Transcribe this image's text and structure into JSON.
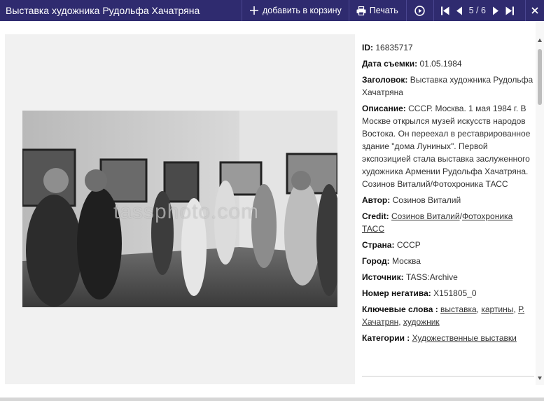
{
  "header": {
    "title": "Выставка художника Рудольфа Хачатряна",
    "add_to_cart_label": "добавить в корзину",
    "print_label": "Печать",
    "pager_text": "5 / 6",
    "icons": {
      "add": "plus-icon",
      "print": "printer-icon",
      "slideshow": "play-circle-icon",
      "first": "first-page-icon",
      "prev": "prev-icon",
      "next": "next-icon",
      "last": "last-page-icon"
    },
    "bg_color": "#2f2b6f"
  },
  "photo": {
    "watermark": "tassphoto.com"
  },
  "info": {
    "id_label": "ID:",
    "id_value": "16835717",
    "date_label": "Дата съемки:",
    "date_value": "01.05.1984",
    "heading_label": "Заголовок:",
    "heading_value": "Выставка художника Рудольфа Хачатряна",
    "description_label": "Описание:",
    "description_value": "СССР. Москва. 1 мая 1984 г. В Москве открылся музей искусств народов Востока. Он переехал в реставрированное здание \"дома Луниных\". Первой экспозицией стала выставка заслуженного художника Армении Рудольфа Хачатряна. Созинов Виталий/Фотохроника ТАСС",
    "author_label": "Автор:",
    "author_value": "Созинов Виталий",
    "credit_label": "Credit:",
    "credit_link_1": "Созинов Виталий",
    "credit_sep": "/",
    "credit_link_2": "Фотохроника ТАСС",
    "country_label": "Страна:",
    "country_value": "СССР",
    "city_label": "Город:",
    "city_value": "Москва",
    "source_label": "Источник:",
    "source_value": "TASS:Archive",
    "negative_label": "Номер негатива:",
    "negative_value": "X151805_0",
    "keywords_label": "Ключевые слова :",
    "keywords": [
      "выставка",
      "картины",
      "Р. Хачатрян",
      "художник"
    ],
    "keyword_sep": ", ",
    "categories_label": "Категории :",
    "categories_value": "Художественные выставки"
  }
}
